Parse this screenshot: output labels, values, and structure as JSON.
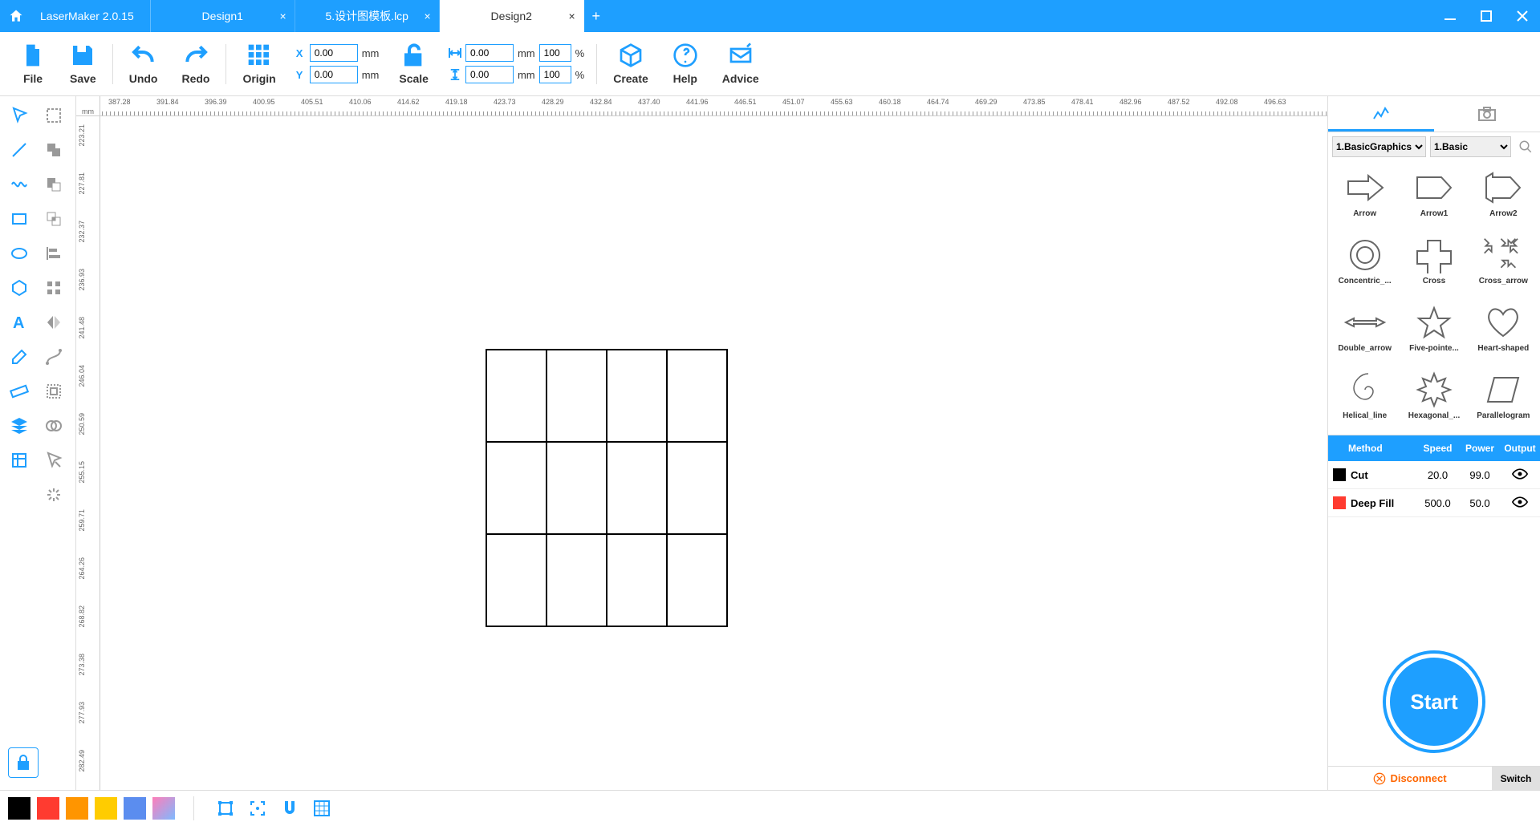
{
  "app": {
    "title": "LaserMaker 2.0.15"
  },
  "tabs": [
    {
      "label": "Design1",
      "active": false
    },
    {
      "label": "5.设计图模板.lcp",
      "active": false
    },
    {
      "label": "Design2",
      "active": true
    }
  ],
  "toolbar": {
    "file": "File",
    "save": "Save",
    "undo": "Undo",
    "redo": "Redo",
    "origin": "Origin",
    "scale": "Scale",
    "create": "Create",
    "help": "Help",
    "advice": "Advice",
    "x_label": "X",
    "y_label": "Y",
    "x_value": "0.00",
    "y_value": "0.00",
    "w_value": "0.00",
    "h_value": "0.00",
    "w_pct": "100",
    "h_pct": "100",
    "mm": "mm",
    "pct": "%"
  },
  "ruler": {
    "unit": "mm",
    "h_ticks": [
      "387.28",
      "391.84",
      "396.39",
      "400.95",
      "405.51",
      "410.06",
      "414.62",
      "419.18",
      "423.73",
      "428.29",
      "432.84",
      "437.40",
      "441.96",
      "446.51",
      "451.07",
      "455.63",
      "460.18",
      "464.74",
      "469.29",
      "473.85",
      "478.41",
      "482.96",
      "487.52",
      "492.08",
      "496.63"
    ],
    "v_ticks": [
      "223.21",
      "227.81",
      "232.37",
      "236.93",
      "241.48",
      "246.04",
      "250.59",
      "255.15",
      "259.71",
      "264.26",
      "268.82",
      "273.38",
      "277.93",
      "282.49"
    ]
  },
  "shapes": {
    "cat1": "1.BasicGraphics",
    "cat2": "1.Basic",
    "items": [
      "Arrow",
      "Arrow1",
      "Arrow2",
      "Concentric_...",
      "Cross",
      "Cross_arrow",
      "Double_arrow",
      "Five-pointe...",
      "Heart-shaped",
      "Helical_line",
      "Hexagonal_...",
      "Parallelogram"
    ]
  },
  "layers": {
    "header": {
      "method": "Method",
      "speed": "Speed",
      "power": "Power",
      "output": "Output"
    },
    "rows": [
      {
        "color": "#000000",
        "method": "Cut",
        "speed": "20.0",
        "power": "99.0"
      },
      {
        "color": "#ff3b30",
        "method": "Deep Fill",
        "speed": "500.0",
        "power": "50.0"
      }
    ]
  },
  "start": {
    "label": "Start"
  },
  "status": {
    "disconnect": "Disconnect",
    "switch": "Switch"
  },
  "colors": [
    "#000000",
    "#ff3b30",
    "#ff9500",
    "#ffcc00",
    "#5b8def",
    "#ff7eb9"
  ]
}
